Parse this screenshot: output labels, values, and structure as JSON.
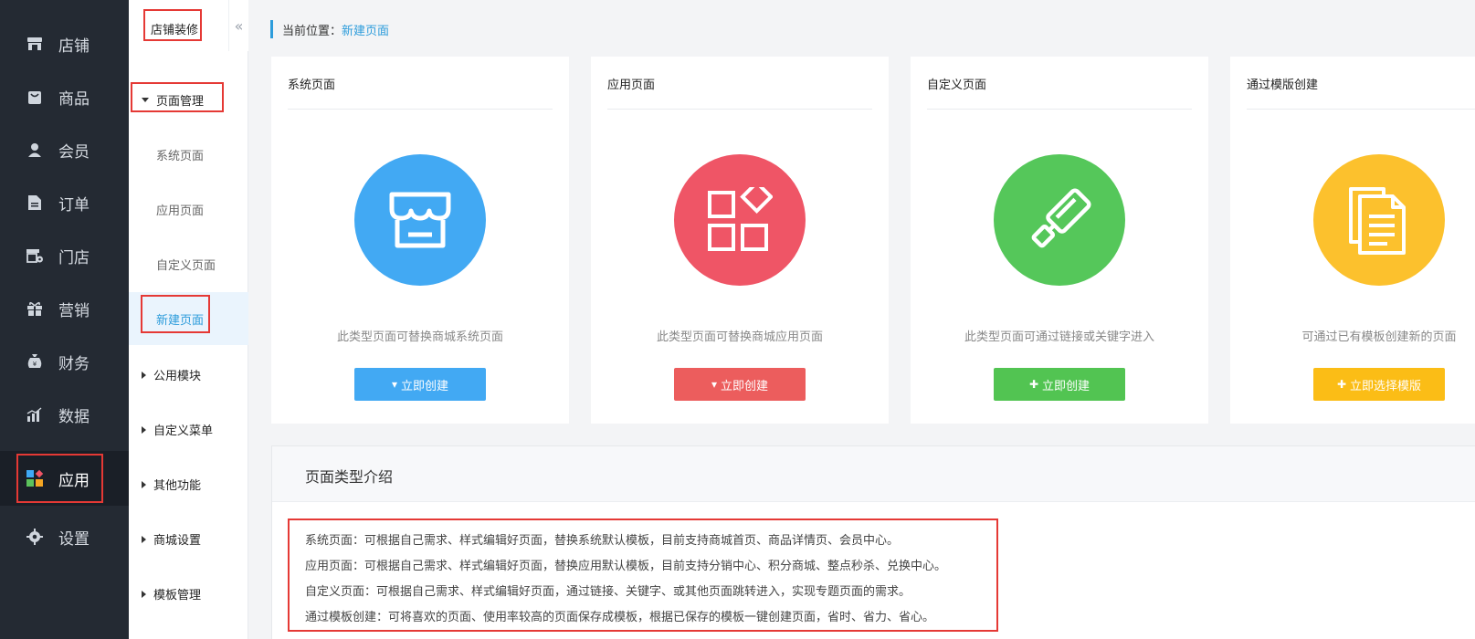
{
  "nav": {
    "items": [
      {
        "label": "店铺",
        "icon": "store-icon"
      },
      {
        "label": "商品",
        "icon": "bag-icon"
      },
      {
        "label": "会员",
        "icon": "user-icon"
      },
      {
        "label": "订单",
        "icon": "document-icon"
      },
      {
        "label": "门店",
        "icon": "shop-settings-icon"
      },
      {
        "label": "营销",
        "icon": "gift-icon"
      },
      {
        "label": "财务",
        "icon": "money-bag-icon"
      },
      {
        "label": "数据",
        "icon": "bar-chart-icon"
      },
      {
        "label": "应用",
        "icon": "apps-icon",
        "active": true
      },
      {
        "label": "设置",
        "icon": "gear-icon"
      }
    ]
  },
  "subnav": {
    "title": "店铺装修",
    "collapse_icon": "double-chevron-left-icon",
    "section_page": "页面管理",
    "items": [
      "系统页面",
      "应用页面",
      "自定义页面",
      "新建页面"
    ],
    "sections": [
      "公用模块",
      "自定义菜单",
      "其他功能",
      "商城设置",
      "模板管理"
    ]
  },
  "breadcrumb": {
    "prefix": "当前位置：",
    "current": "新建页面"
  },
  "cards": [
    {
      "title": "系统页面",
      "desc": "此类型页面可替换商城系统页面",
      "button": "立即创建",
      "button_icon": "▾",
      "color": "#42a9f3",
      "btn_color": "#42a9f3",
      "icon": "storefront-icon"
    },
    {
      "title": "应用页面",
      "desc": "此类型页面可替换商城应用页面",
      "button": "立即创建",
      "button_icon": "▾",
      "color": "#ef5566",
      "btn_color": "#ec5d5d",
      "icon": "app-grid-icon"
    },
    {
      "title": "自定义页面",
      "desc": "此类型页面可通过链接或关键字进入",
      "button": "立即创建",
      "button_icon": "✚",
      "color": "#55c75a",
      "btn_color": "#52c452",
      "icon": "paint-roller-icon"
    },
    {
      "title": "通过模版创建",
      "desc": "可通过已有模板创建新的页面",
      "button": "立即选择模版",
      "button_icon": "✚",
      "color": "#fcc12d",
      "btn_color": "#fbbd16",
      "icon": "documents-icon"
    }
  ],
  "intro": {
    "title": "页面类型介绍",
    "lines": [
      "系统页面：可根据自己需求、样式编辑好页面，替换系统默认模板，目前支持商城首页、商品详情页、会员中心。",
      "应用页面：可根据自己需求、样式编辑好页面，替换应用默认模板，目前支持分销中心、积分商城、整点秒杀、兑换中心。",
      "自定义页面：可根据自己需求、样式编辑好页面，通过链接、关键字、或其他页面跳转进入，实现专题页面的需求。",
      "通过模板创建：可将喜欢的页面、使用率较高的页面保存成模板，根据已保存的模板一键创建页面，省时、省力、省心。"
    ]
  }
}
